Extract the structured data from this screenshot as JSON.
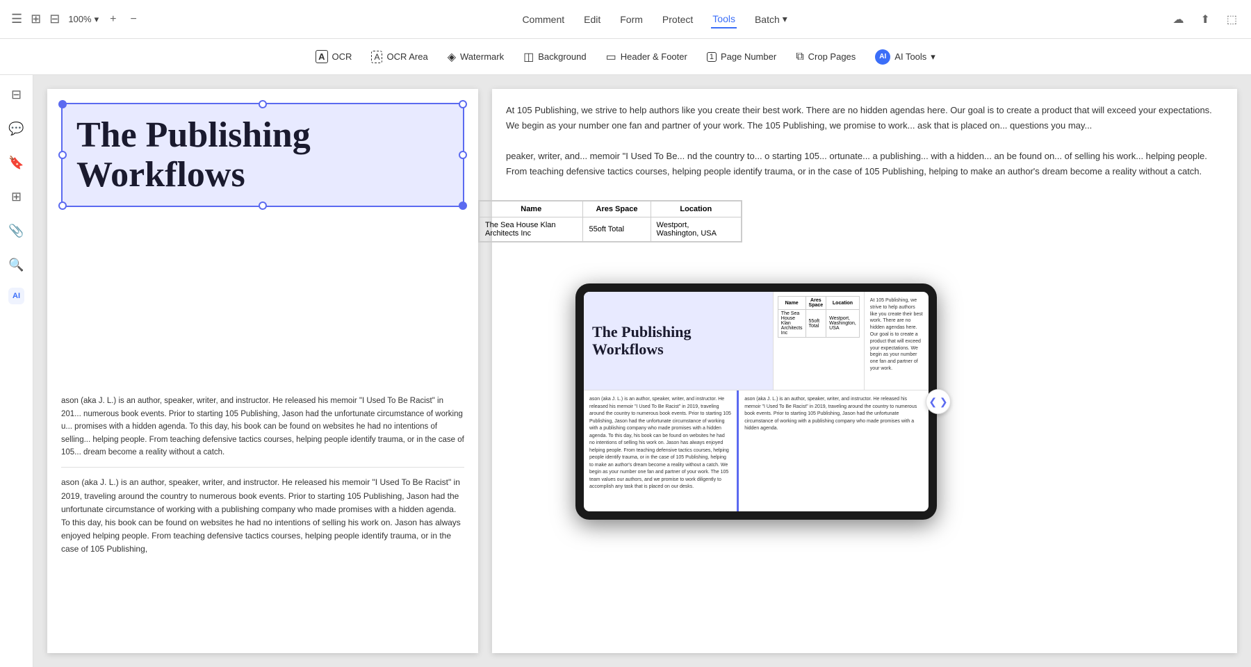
{
  "topbar": {
    "zoom": "100%",
    "nav_items": [
      "Comment",
      "Edit",
      "Form",
      "Protect",
      "Tools",
      "Batch"
    ],
    "active_nav": "Tools",
    "batch_has_arrow": true
  },
  "toolbar": {
    "items": [
      {
        "id": "ocr",
        "label": "OCR",
        "icon": "A"
      },
      {
        "id": "ocr-area",
        "label": "OCR Area",
        "icon": "⬚"
      },
      {
        "id": "watermark",
        "label": "Watermark",
        "icon": "◈"
      },
      {
        "id": "background",
        "label": "Background",
        "icon": "◫"
      },
      {
        "id": "header-footer",
        "label": "Header & Footer",
        "icon": "▭"
      },
      {
        "id": "page-number",
        "label": "Page Number",
        "icon": "①"
      },
      {
        "id": "crop-pages",
        "label": "Crop Pages",
        "icon": "⧉"
      },
      {
        "id": "ai-tools",
        "label": "AI Tools",
        "icon": "AI"
      }
    ]
  },
  "sidebar": {
    "icons": [
      {
        "id": "pages",
        "icon": "⊟",
        "active": false
      },
      {
        "id": "comments",
        "icon": "💬",
        "active": false
      },
      {
        "id": "bookmarks",
        "icon": "🔖",
        "active": false
      },
      {
        "id": "layers",
        "icon": "⊞",
        "active": false
      },
      {
        "id": "attachments",
        "icon": "📎",
        "active": false
      },
      {
        "id": "search",
        "icon": "🔍",
        "active": false
      },
      {
        "id": "ai",
        "icon": "AI",
        "active": true
      }
    ]
  },
  "document": {
    "title": "The Publishing Workflows",
    "table": {
      "headers": [
        "Name",
        "Ares Space",
        "Location"
      ],
      "rows": [
        [
          "The Sea House Klan Architects Inc",
          "55oft Total",
          "Westport, Washington, USA"
        ]
      ]
    },
    "body_text_1": "ason (aka J. L.) is an author, speaker, writer, and instructor. He released his memoir \"I Used To Be Racist\" in 201... numerous book events. Prior to starting 105 Publishing, Jason had the unfortunate circumstance of working u... promises with a hidden agenda. To this day, his book can be found on websites he had no intentions of selling... helping people. From teaching defensive tactics courses, helping people identify trauma, or in the case of 105... dream become a reality without a catch.",
    "body_text_2": "ason (aka J. L.) is an author, speaker, writer, and instructor. He released his memoir \"I Used To Be Racist\" in 2019, traveling around the country to numerous book events. Prior to starting 105 Publishing, Jason had the unfortunate circumstance of working with a publishing company who made promises with a hidden agenda. To this day, his book can be found on websites he had no intentions of selling his work on. Jason has always enjoyed helping people. From teaching defensive tactics courses, helping people identify trauma, or in the case of 105 Publishing,",
    "right_text": "At 105 Publishing, we strive to help authors like you create their best work. There are no hidden agendas here. Our goal is to create a product that will exceed your expectations. We begin as your number one fan and partner of your work. The 105 Publishing, we promise to work... ask that is placed on... questions you may... peaker, writer, and... memoir \"I Used To Be... nd the country to... o starting 105... ortunate... a publishing... with a hidden... an be found on... of selling his work... helping people. From teaching defensive tactics courses, helping people identify trauma, or in the case of 105 Publishing, helping to make an author's dream become a reality without a catch."
  },
  "tablet": {
    "title": "The Publishing Workflows",
    "table": {
      "headers": [
        "Name",
        "Ares Space",
        "Location"
      ],
      "rows": [
        [
          "The Sea House Klan Architects Inc",
          "55oft Total",
          "Westport, Washington, USA"
        ]
      ]
    },
    "right_text": "At 105 Publishing, we strive to help authors like you create their best work. There are no hidden agendas here. Our goal is to create a product that will exceed your expectations.",
    "body_left": "ason (aka J. L.) is an author, speaker, writer, and instructor. He released his memoir \"I Used To Be Racist\" in 2019, traveling around the country to numerous book events. Prior to starting 105 Publishing, Jason had the unfortunate circumstance of working with a publishing company who made promises with a hidden agenda. To this day, his book can be found on websites he had no intentions of selling his work on. Jason has always enjoyed helping people. From teaching defensive tactics courses, helping people identify trauma, or in the case of 105 Publishing, helping to make an author's dream become a reality without a catch. We begin as your number one fan and partner of your work. The 105 team values our authors, and we promise to work diligently to accomplish any task that is placed on our desks.",
    "body_right": "ason (aka J. L.) is an author, speaker, writer, and instructor. He released his memoir \"I Used To Be Racist\" in 2019, traveling around the country to numerous book events. Prior to starting 105 Publishing, Jason had the unfortunate circumstance of working with a publishing company who made promises with a hidden agenda."
  }
}
